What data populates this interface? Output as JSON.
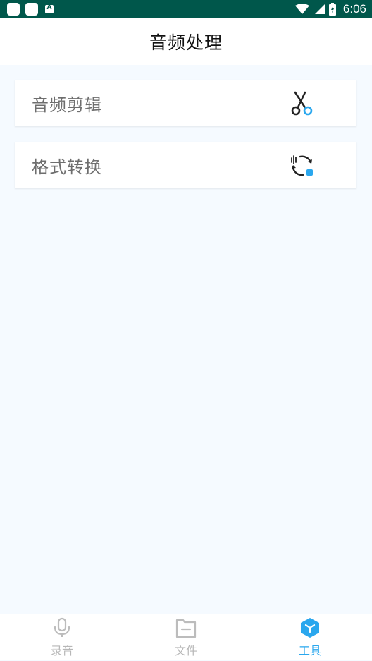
{
  "status_bar": {
    "time": "6:06"
  },
  "app_bar": {
    "title": "音频处理"
  },
  "tools": [
    {
      "label": "音频剪辑",
      "icon": "scissors-icon"
    },
    {
      "label": "格式转换",
      "icon": "format-convert-icon"
    }
  ],
  "bottom_nav": {
    "items": [
      {
        "label": "录音",
        "icon": "microphone-icon",
        "active": false
      },
      {
        "label": "文件",
        "icon": "folder-icon",
        "active": false
      },
      {
        "label": "工具",
        "icon": "toolbox-icon",
        "active": true
      }
    ]
  },
  "colors": {
    "status_bar": "#00574b",
    "accent": "#2aa7ee",
    "background": "#f5faff",
    "inactive": "#b7b7b7"
  }
}
